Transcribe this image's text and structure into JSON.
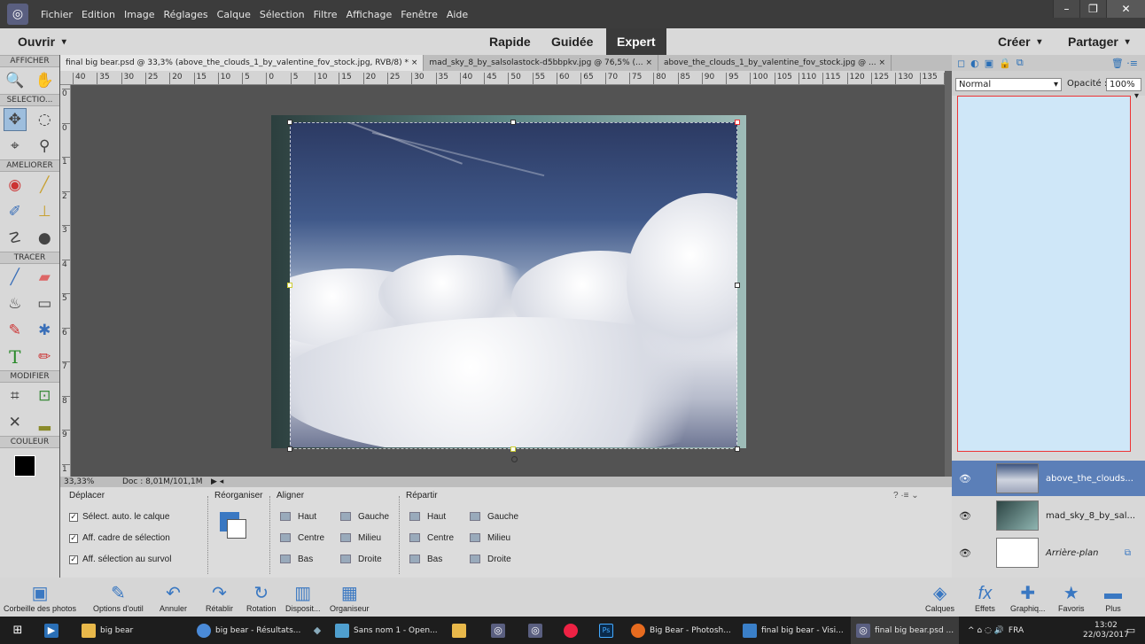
{
  "menubar": {
    "items": [
      "Fichier",
      "Edition",
      "Image",
      "Réglages",
      "Calque",
      "Sélection",
      "Filtre",
      "Affichage",
      "Fenêtre",
      "Aide"
    ]
  },
  "window_controls": {
    "minimize": "–",
    "maximize": "❐",
    "close": "✕"
  },
  "modebar": {
    "open": "Ouvrir",
    "modes": [
      "Rapide",
      "Guidée",
      "Expert"
    ],
    "create": "Créer",
    "share": "Partager"
  },
  "toolbox": {
    "sections": [
      "AFFICHER",
      "SELECTIO...",
      "AMELIORER",
      "TRACER",
      "MODIFIER",
      "COULEUR"
    ]
  },
  "tabs": [
    {
      "label": "final big bear.psd @ 33,3% (above_the_clouds_1_by_valentine_fov_stock.jpg, RVB/8) *",
      "close": "×"
    },
    {
      "label": "mad_sky_8_by_salsolastock-d5bbpkv.jpg @ 76,5% (...",
      "close": "×"
    },
    {
      "label": "above_the_clouds_1_by_valentine_fov_stock.jpg @ ...",
      "close": "×"
    }
  ],
  "ruler": {
    "h_ticks": [
      "40",
      "35",
      "30",
      "25",
      "20",
      "15",
      "10",
      "5",
      "0",
      "5",
      "10",
      "15",
      "20",
      "25",
      "30",
      "35",
      "40",
      "45",
      "50",
      "55",
      "60",
      "65",
      "70",
      "75",
      "80",
      "85",
      "90",
      "95",
      "100",
      "105",
      "110",
      "115",
      "120",
      "125",
      "130",
      "135",
      "1"
    ],
    "v_ticks": [
      "0",
      "0",
      "1",
      "2",
      "3",
      "4",
      "5",
      "6",
      "7",
      "8",
      "9",
      "1"
    ]
  },
  "status": {
    "zoom": "33,33%",
    "doc": "Doc : 8,01M/101,1M"
  },
  "options": {
    "move_title": "Déplacer",
    "checks": [
      "Sélect. auto. le calque",
      "Aff. cadre de sélection",
      "Aff. sélection au survol"
    ],
    "reorganize": "Réorganiser",
    "align_title": "Aligner",
    "align": [
      "Haut",
      "Centre",
      "Bas",
      "Gauche",
      "Milieu",
      "Droite"
    ],
    "distribute_title": "Répartir",
    "distribute": [
      "Haut",
      "Centre",
      "Bas",
      "Gauche",
      "Milieu",
      "Droite"
    ]
  },
  "layers_panel": {
    "blend_mode": "Normal",
    "opacity_label": "Opacité :",
    "opacity": "100%",
    "layers": [
      {
        "name": "above_the_clouds...",
        "selected": true
      },
      {
        "name": "mad_sky_8_by_sal...",
        "selected": false
      },
      {
        "name": "Arrière-plan",
        "selected": false
      }
    ]
  },
  "bottombar": {
    "left": [
      "Corbeille des photos",
      "Options d'outil",
      "Annuler",
      "Rétablir",
      "Rotation",
      "Disposit...",
      "Organiseur"
    ],
    "right": [
      "Calques",
      "Effets",
      "Graphiq...",
      "Favoris",
      "Plus"
    ]
  },
  "taskbar": {
    "items": [
      "big bear",
      "big bear - Résultats...",
      "Sans nom 1 - Open...",
      "Big Bear - Photosh...",
      "final big bear - Visi...",
      "final big bear.psd ..."
    ],
    "lang": "FRA",
    "time": "13:02",
    "date": "22/03/2017"
  }
}
